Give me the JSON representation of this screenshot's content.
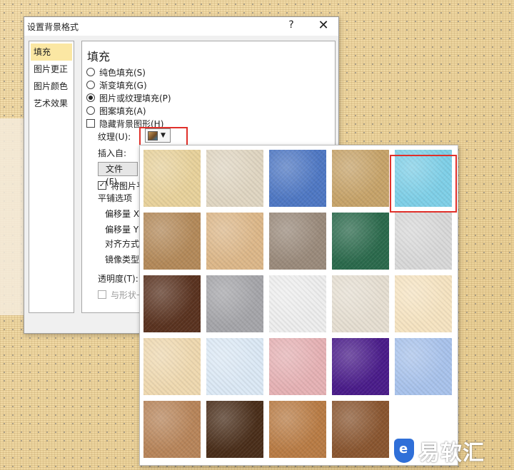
{
  "dialog": {
    "title": "设置背景格式",
    "help": "?",
    "close": "✕"
  },
  "nav": {
    "items": [
      {
        "label": "填充",
        "active": true
      },
      {
        "label": "图片更正"
      },
      {
        "label": "图片颜色"
      },
      {
        "label": "艺术效果"
      }
    ]
  },
  "panel": {
    "heading": "填充",
    "options": [
      {
        "label": "纯色填充(S)",
        "selected": false
      },
      {
        "label": "渐变填充(G)",
        "selected": false
      },
      {
        "label": "图片或纹理填充(P)",
        "selected": true
      },
      {
        "label": "图案填充(A)",
        "selected": false
      }
    ],
    "hide_bg": "隐藏背景图形(H)",
    "texture_label": "纹理(U):",
    "insert_from": "插入自:",
    "file_button": "文件(F)..",
    "tile_as": "将图片平",
    "tile_options": "平铺选项",
    "offset_x": "偏移量 X",
    "offset_y": "偏移量 Y",
    "align": "对齐方式",
    "mirror": "镜像类型",
    "transparency": "透明度(T):",
    "rotate_with_shape": "与形状一"
  },
  "gallery": {
    "textures": [
      {
        "name": "papyrus",
        "color": "#e8d29c"
      },
      {
        "name": "canvas",
        "color": "#e0d6c2"
      },
      {
        "name": "denim",
        "color": "#4f78c4"
      },
      {
        "name": "woven-mat",
        "color": "#c7a46a"
      },
      {
        "name": "water-droplets",
        "color": "#7fd0e8"
      },
      {
        "name": "brown-paper-bag",
        "color": "#b48a5a"
      },
      {
        "name": "fish-fossil",
        "color": "#ddb88a"
      },
      {
        "name": "sand",
        "color": "#9b8b7c"
      },
      {
        "name": "green-marble",
        "color": "#2b6a4c"
      },
      {
        "name": "white-marble",
        "color": "#d9d9d9"
      },
      {
        "name": "brown-marble",
        "color": "#5a3320"
      },
      {
        "name": "granite",
        "color": "#a6a6aa"
      },
      {
        "name": "newsprint",
        "color": "#eeeeee"
      },
      {
        "name": "recycled-paper",
        "color": "#e6dfd2"
      },
      {
        "name": "parchment",
        "color": "#f6e4c2"
      },
      {
        "name": "stationery",
        "color": "#efd9b0"
      },
      {
        "name": "blue-tissue-paper",
        "color": "#dce9f5"
      },
      {
        "name": "pink-tissue-paper",
        "color": "#e6b2b5"
      },
      {
        "name": "purple-mesh",
        "color": "#4a1c8a"
      },
      {
        "name": "bouquet",
        "color": "#a9c3ec"
      },
      {
        "name": "cork",
        "color": "#b8855a"
      },
      {
        "name": "walnut",
        "color": "#4a2e1a"
      },
      {
        "name": "oak",
        "color": "#b97c45"
      },
      {
        "name": "medium-wood",
        "color": "#8a5630"
      }
    ]
  },
  "watermark": {
    "text": "易软汇"
  },
  "colors": {
    "highlight": "#e0302a",
    "nav_active": "#fbe7a3"
  }
}
